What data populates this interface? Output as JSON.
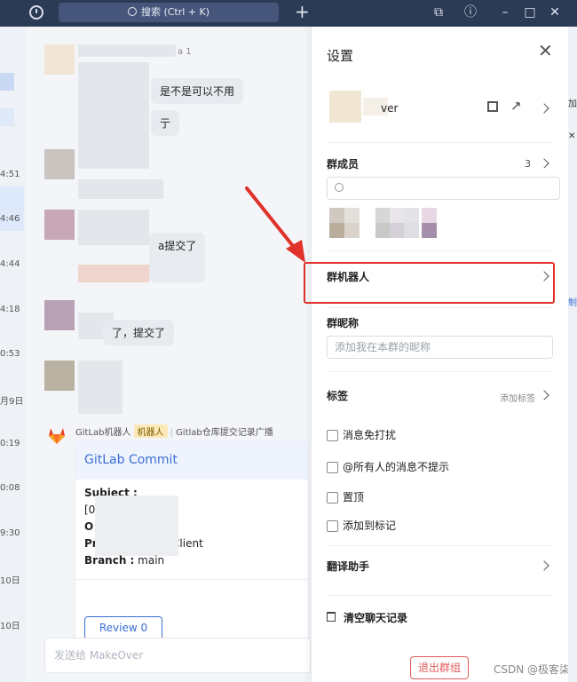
{
  "titlebar": {
    "search_placeholder": "搜索 (Ctrl + K)",
    "icons": [
      "history-icon",
      "search-icon",
      "plus-icon",
      "screen-share-icon",
      "help-icon",
      "minimize-icon",
      "maximize-icon",
      "close-icon"
    ]
  },
  "left_strip": {
    "times": [
      "4:51",
      "4:46",
      "4:44",
      "4:18",
      "0:53",
      "月9日",
      "0:19",
      "0:08",
      "9:30",
      "10日",
      "10日"
    ]
  },
  "chat": {
    "messages": [
      {
        "text": "是不是可以不用"
      },
      {
        "text": "亍"
      },
      {
        "text": "a提交了"
      },
      {
        "text": "了，提交了"
      }
    ],
    "top_count": "a 1",
    "gitlab": {
      "sender": "GitLab机器人",
      "robot_badge": "机器人",
      "source": "Gitlab仓库提交记录广播",
      "card_title": "GitLab Commit",
      "subject_label": "Subject :",
      "line2": "[0",
      "line3": "O",
      "line4_prefix": "Pr",
      "line4_suffix": "-Client",
      "branch_label": "Branch :",
      "branch_value": "main",
      "review_button": "Review 0"
    },
    "input_placeholder": "发送给 MakeOver"
  },
  "settings": {
    "title": "设置",
    "group_name": "ver",
    "members_label": "群成员",
    "members_count": "3",
    "robot_label": "群机器人",
    "nickname_label": "群昵称",
    "nickname_placeholder": "添加我在本群的昵称",
    "tags_label": "标签",
    "add_tag": "添加标签",
    "checkboxes": [
      {
        "label": "消息免打扰",
        "checked": false
      },
      {
        "label": "@所有人的消息不提示",
        "checked": false
      },
      {
        "label": "置顶",
        "checked": false
      },
      {
        "label": "添加到标记",
        "checked": false
      }
    ],
    "translate_label": "翻译助手",
    "clear_label": "清空聊天记录",
    "exit_button": "退出群组"
  },
  "right_edge": {
    "texts": [
      "加",
      "制"
    ]
  },
  "watermark": "CSDN @极客柒",
  "colors": {
    "titlebar": "#2b3a55",
    "accent": "#3b6fd4",
    "annotation": "#e0312a",
    "danger": "#e05a5a"
  }
}
